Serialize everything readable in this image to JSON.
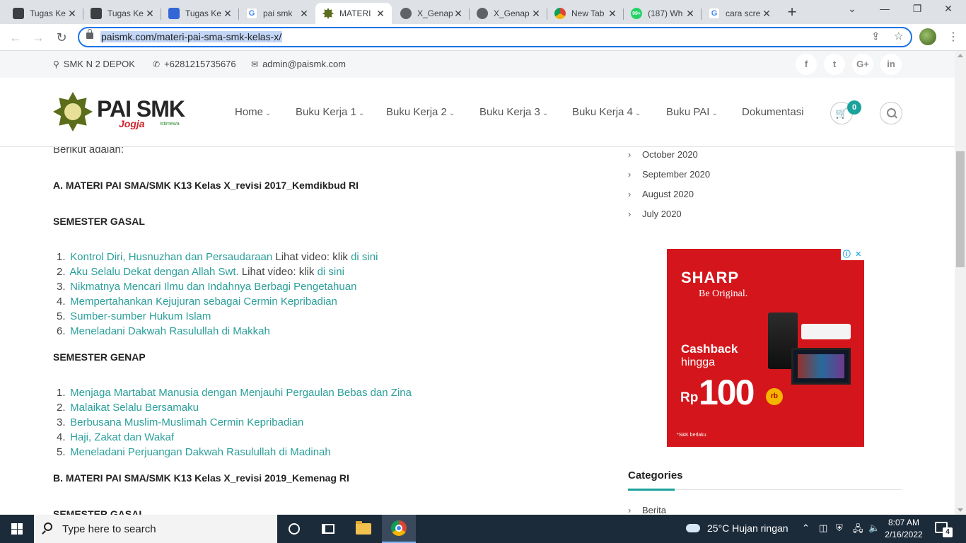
{
  "browser": {
    "tabs": [
      {
        "title": "Tugas Ke",
        "favicon": "classroom-icon",
        "active": false
      },
      {
        "title": "Tugas Ke",
        "favicon": "classroom-icon",
        "active": false
      },
      {
        "title": "Tugas Ke",
        "favicon": "google-docs-icon",
        "active": false
      },
      {
        "title": "pai smk",
        "favicon": "google-icon",
        "active": false
      },
      {
        "title": "MATERI",
        "favicon": "pai-smk-icon",
        "active": true
      },
      {
        "title": "X_Genap",
        "favicon": "globe-icon",
        "active": false
      },
      {
        "title": "X_Genap",
        "favicon": "globe-icon",
        "active": false
      },
      {
        "title": "New Tab",
        "favicon": "chrome-icon",
        "active": false
      },
      {
        "title": "(187) Wh",
        "favicon": "whatsapp-icon",
        "active": false
      },
      {
        "title": "cara scre",
        "favicon": "google-icon",
        "active": false
      }
    ],
    "whatsapp_badge": "99+",
    "url": "paismk.com/materi-pai-sma-smk-kelas-x/"
  },
  "topbar": {
    "location": "SMK N 2 DEPOK",
    "phone": "+6281215735676",
    "email": "admin@paismk.com",
    "social": [
      "f",
      "t",
      "G+",
      "in"
    ]
  },
  "header": {
    "logo_text": "PAI SMK",
    "logo_sub": "Jogja",
    "logo_tiny": "Istimewa",
    "menu": [
      {
        "label": "Home",
        "dropdown": true
      },
      {
        "label": "Buku Kerja 1",
        "dropdown": true
      },
      {
        "label": "Buku Kerja 2",
        "dropdown": true
      },
      {
        "label": "Buku Kerja 3",
        "dropdown": true
      },
      {
        "label": "Buku Kerja 4",
        "dropdown": true
      },
      {
        "label": "Buku PAI",
        "dropdown": true
      },
      {
        "label": "Dokumentasi",
        "dropdown": false
      }
    ],
    "cart_count": "0"
  },
  "article": {
    "intro": "Berikut adalah:",
    "section_a": "A. MATERI PAI SMA/SMK K13 Kelas X_revisi 2017_Kemdikbud RI",
    "semester_gasal_label": "SEMESTER GASAL",
    "gasal_items": [
      {
        "num": "1.",
        "link": "Kontrol Diri, Husnuzhan dan Persaudaraan",
        "after": " Lihat video: klik ",
        "link2": "di sini"
      },
      {
        "num": "2.",
        "link": "Aku Selalu Dekat dengan Allah Swt.",
        "after": " Lihat video: klik ",
        "link2": "di sini"
      },
      {
        "num": "3.",
        "link": "Nikmatnya Mencari Ilmu dan Indahnya Berbagi Pengetahuan",
        "after": "",
        "link2": ""
      },
      {
        "num": "4.",
        "link": "Mempertahankan Kejujuran sebagai Cermin Kepribadian",
        "after": "",
        "link2": ""
      },
      {
        "num": "5.",
        "link": "Sumber-sumber Hukum Islam",
        "after": "",
        "link2": ""
      },
      {
        "num": "6.",
        "link": "Meneladani Dakwah Rasulullah di Makkah",
        "after": "",
        "link2": ""
      }
    ],
    "semester_genap_label": "SEMESTER GENAP",
    "genap_items": [
      {
        "num": "1.",
        "link": "Menjaga Martabat Manusia dengan Menjauhi Pergaulan Bebas dan Zina"
      },
      {
        "num": "2.",
        "link": "Malaikat Selalu Bersamaku"
      },
      {
        "num": "3.",
        "link": "Berbusana Muslim-Muslimah Cermin Kepribadian"
      },
      {
        "num": "4.",
        "link": "Haji, Zakat dan Wakaf"
      },
      {
        "num": "5.",
        "link": "Meneladani Perjuangan Dakwah Rasulullah di Madinah"
      }
    ],
    "section_b": "B. MATERI PAI SMA/SMK K13 Kelas X_revisi 2019_Kemenag RI",
    "semester_gasal_label_2": "SEMESTER GASAL"
  },
  "sidebar": {
    "archives": [
      "October 2020",
      "September 2020",
      "August 2020",
      "July 2020"
    ],
    "ad": {
      "brand": "SHARP",
      "tagline": "Be Original.",
      "cashback": "Cashback",
      "hingga": "hingga",
      "currency": "Rp",
      "amount": "100",
      "unit": "rb",
      "note": "*S&K berlaku"
    },
    "categories_title": "Categories",
    "categories": [
      "Berita"
    ]
  },
  "taskbar": {
    "search_placeholder": "Type here to search",
    "weather": "25°C  Hujan ringan",
    "time": "8:07 AM",
    "date": "2/16/2022",
    "notifications": "4"
  },
  "colors": {
    "link": "#2b9f9a",
    "accent": "#1aa39c",
    "ad_red": "#d4161c",
    "taskbar": "#1c2b3a"
  }
}
